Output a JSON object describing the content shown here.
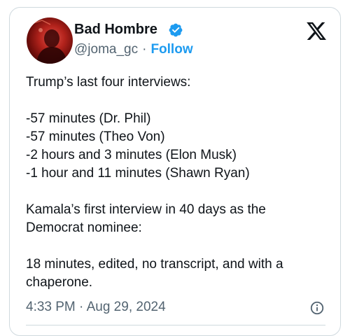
{
  "author": {
    "display_name": "Bad Hombre",
    "handle": "@joma_gc",
    "separator": "·",
    "follow_label": "Follow",
    "verified_icon": "verified-badge-icon"
  },
  "tweet": {
    "lines": [
      "Trump’s last four interviews:",
      "",
      "-57 minutes (Dr. Phil)",
      "-57 minutes (Theo Von)",
      "-2 hours and 3 minutes (Elon Musk)",
      "-1 hour and 11 minutes (Shawn Ryan)",
      "",
      "Kamala’s first interview in 40 days as the",
      "Democrat nominee:",
      "",
      "18 minutes, edited, no transcript, and with a",
      "chaperone."
    ],
    "timestamp": "4:33 PM · Aug 29, 2024"
  },
  "colors": {
    "text": "#0f1419",
    "secondary": "#536471",
    "accent": "#1d9bf0",
    "border": "#cfd9de"
  }
}
